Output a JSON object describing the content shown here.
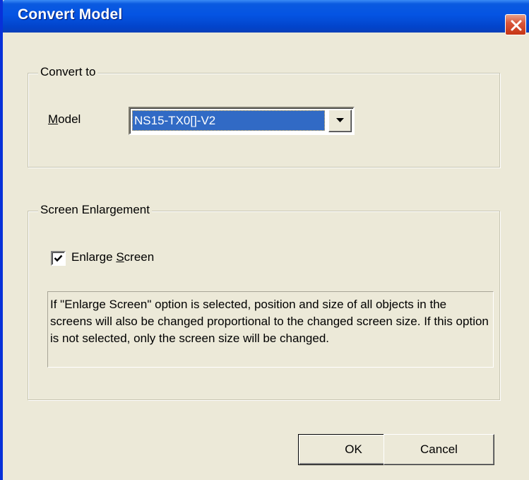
{
  "window": {
    "title": "Convert Model"
  },
  "convert_to": {
    "legend": "Convert to",
    "model_label_underlined": "M",
    "model_label_rest": "odel",
    "model_value": "NS15-TX0[]-V2"
  },
  "screen_enlargement": {
    "legend": "Screen Enlargement",
    "checkbox_checked": true,
    "checkbox_label_prefix": "Enlarge ",
    "checkbox_label_underlined": "S",
    "checkbox_label_suffix": "creen",
    "info_text": "If \"Enlarge Screen\" option is selected, position and size of all objects in the screens will also be changed proportional to the changed screen size. If this option is not selected, only the screen size will be changed."
  },
  "buttons": {
    "ok_label": "OK",
    "cancel_label": "Cancel"
  },
  "icons": {
    "close": "close-icon",
    "dropdown": "chevron-down-icon",
    "check": "check-icon"
  },
  "colors": {
    "titlebar": "#0554e3",
    "selection": "#316ac5",
    "close_button": "#d9573c",
    "dialog_background": "#ece9d8"
  }
}
